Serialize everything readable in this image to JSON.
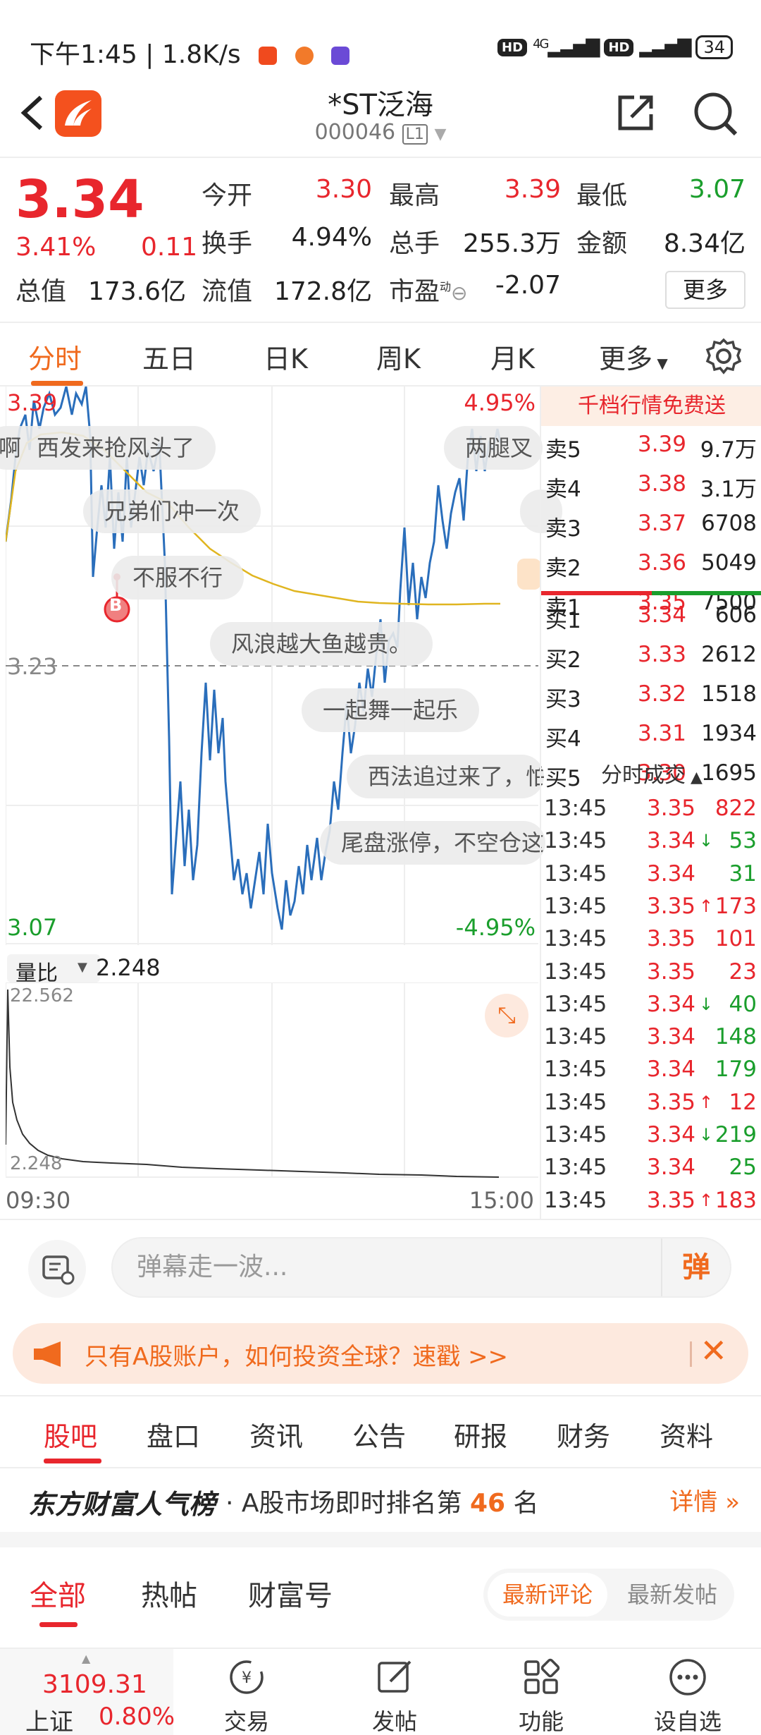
{
  "status": {
    "time": "下午1:45 | 1.8K/s",
    "hd1": "HD",
    "hd2": "HD",
    "battery": "34",
    "net": "4G"
  },
  "header": {
    "title": "*ST泛海",
    "code": "000046",
    "level": "L1"
  },
  "quote": {
    "price": "3.34",
    "pct": "3.41%",
    "chg": "0.11",
    "labels": {
      "open": "今开",
      "high": "最高",
      "low": "最低",
      "turnover": "换手",
      "volume": "总手",
      "amount": "金额",
      "mktcap": "总值",
      "float": "流值",
      "pe": "市盈"
    },
    "values": {
      "open": "3.30",
      "high": "3.39",
      "low": "3.07",
      "turnover": "4.94%",
      "volume": "255.3万",
      "amount": "8.34亿",
      "mktcap": "173.6亿",
      "float": "172.8亿",
      "pe": "-2.07"
    },
    "pe_sup": "动",
    "more": "更多"
  },
  "tabs": [
    "分时",
    "五日",
    "日K",
    "周K",
    "月K",
    "更多"
  ],
  "chart": {
    "top_price": "3.39",
    "top_pct": "4.95%",
    "mid_price": "3.23",
    "bot_price": "3.07",
    "bot_pct": "-4.95%",
    "marker": "B",
    "danmu": [
      "啊",
      "西发来抢风头了",
      "两腿叉",
      "兄弟们冲一次",
      "不服不行",
      "风浪越大鱼越贵。",
      "一起舞一起乐",
      "西法追过来了，怕",
      "尾盘涨停，不空仓这"
    ]
  },
  "volume": {
    "label": "量比",
    "value": "2.248",
    "max": "22.562",
    "cur": "2.248",
    "start_time": "09:30",
    "end_time": "15:00"
  },
  "book": {
    "promo": "千档行情免费送",
    "asks": [
      {
        "l": "卖5",
        "p": "3.39",
        "v": "9.7万"
      },
      {
        "l": "卖4",
        "p": "3.38",
        "v": "3.1万"
      },
      {
        "l": "卖3",
        "p": "3.37",
        "v": "6708"
      },
      {
        "l": "卖2",
        "p": "3.36",
        "v": "5049"
      },
      {
        "l": "卖1",
        "p": "3.35",
        "v": "7500"
      }
    ],
    "bids": [
      {
        "l": "买1",
        "p": "3.34",
        "v": "606"
      },
      {
        "l": "买2",
        "p": "3.33",
        "v": "2612"
      },
      {
        "l": "买3",
        "p": "3.32",
        "v": "1518"
      },
      {
        "l": "买4",
        "p": "3.31",
        "v": "1934"
      },
      {
        "l": "买5",
        "p": "3.30",
        "v": "1695"
      }
    ],
    "trades_title": "分时成交",
    "trades": [
      {
        "t": "13:45",
        "p": "3.35",
        "a": "",
        "v": "822",
        "vc": "red"
      },
      {
        "t": "13:45",
        "p": "3.34",
        "a": "↓",
        "v": "53",
        "vc": "green"
      },
      {
        "t": "13:45",
        "p": "3.34",
        "a": "",
        "v": "31",
        "vc": "green"
      },
      {
        "t": "13:45",
        "p": "3.35",
        "a": "↑",
        "v": "173",
        "vc": "red"
      },
      {
        "t": "13:45",
        "p": "3.35",
        "a": "",
        "v": "101",
        "vc": "red"
      },
      {
        "t": "13:45",
        "p": "3.35",
        "a": "",
        "v": "23",
        "vc": "red"
      },
      {
        "t": "13:45",
        "p": "3.34",
        "a": "↓",
        "v": "40",
        "vc": "green"
      },
      {
        "t": "13:45",
        "p": "3.34",
        "a": "",
        "v": "148",
        "vc": "green"
      },
      {
        "t": "13:45",
        "p": "3.34",
        "a": "",
        "v": "179",
        "vc": "green"
      },
      {
        "t": "13:45",
        "p": "3.35",
        "a": "↑",
        "v": "12",
        "vc": "red"
      },
      {
        "t": "13:45",
        "p": "3.34",
        "a": "↓",
        "v": "219",
        "vc": "green"
      },
      {
        "t": "13:45",
        "p": "3.34",
        "a": "",
        "v": "25",
        "vc": "green"
      },
      {
        "t": "13:45",
        "p": "3.35",
        "a": "↑",
        "v": "183",
        "vc": "red"
      }
    ]
  },
  "comment": {
    "placeholder": "弹幕走一波...",
    "btn": "弹"
  },
  "banner": {
    "text": "只有A股账户，如何投资全球？速戳 >>"
  },
  "tabs2": [
    "股吧",
    "盘口",
    "资讯",
    "公告",
    "研报",
    "财务",
    "资料"
  ],
  "rank": {
    "brand": "东方财富人气榜",
    "text": "· A股市场即时排名第",
    "num": "46",
    "unit": "名",
    "detail": "详情"
  },
  "tabs3": [
    "全部",
    "热帖",
    "财富号"
  ],
  "seg": {
    "a": "最新评论",
    "b": "最新发帖"
  },
  "nav": {
    "index_value": "3109.31",
    "index_name": "上证",
    "index_pct": "0.80%",
    "items": [
      "交易",
      "发帖",
      "功能",
      "设自选"
    ]
  },
  "colors": {
    "up": "#e8262d",
    "down": "#1a9e2c",
    "accent": "#f06a1e",
    "price_line": "#2a6ebb",
    "avg_line": "#e0b520"
  }
}
